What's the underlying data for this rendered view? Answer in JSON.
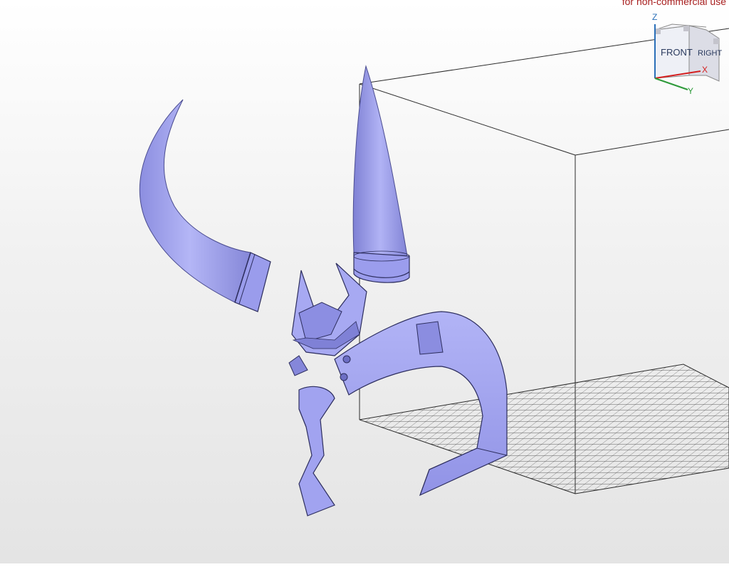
{
  "license_note": "for non-commercial use",
  "view_cube": {
    "front_label": "FRONT",
    "right_label": "RIGHT",
    "axis_z": "Z",
    "axis_x": "X",
    "axis_y": "Y"
  },
  "colors": {
    "model_fill": "#a3a5f0",
    "model_shadow": "#6e70c8",
    "model_edge": "#2d2e5e",
    "build_volume_line": "#2b2b2b",
    "bed_grid": "#3a3a3a",
    "license_note": "#a82020",
    "axis_x": "#d42020",
    "axis_y": "#2e9a3a",
    "axis_z": "#2a6fb8"
  }
}
